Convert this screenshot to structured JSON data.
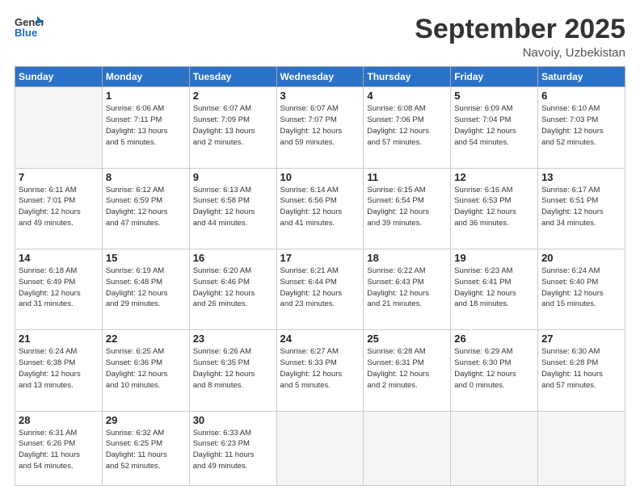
{
  "header": {
    "logo_line1": "General",
    "logo_line2": "Blue",
    "month_title": "September 2025",
    "location": "Navoiy, Uzbekistan"
  },
  "weekdays": [
    "Sunday",
    "Monday",
    "Tuesday",
    "Wednesday",
    "Thursday",
    "Friday",
    "Saturday"
  ],
  "weeks": [
    [
      {
        "day": "",
        "info": ""
      },
      {
        "day": "1",
        "info": "Sunrise: 6:06 AM\nSunset: 7:11 PM\nDaylight: 13 hours\nand 5 minutes."
      },
      {
        "day": "2",
        "info": "Sunrise: 6:07 AM\nSunset: 7:09 PM\nDaylight: 13 hours\nand 2 minutes."
      },
      {
        "day": "3",
        "info": "Sunrise: 6:07 AM\nSunset: 7:07 PM\nDaylight: 12 hours\nand 59 minutes."
      },
      {
        "day": "4",
        "info": "Sunrise: 6:08 AM\nSunset: 7:06 PM\nDaylight: 12 hours\nand 57 minutes."
      },
      {
        "day": "5",
        "info": "Sunrise: 6:09 AM\nSunset: 7:04 PM\nDaylight: 12 hours\nand 54 minutes."
      },
      {
        "day": "6",
        "info": "Sunrise: 6:10 AM\nSunset: 7:03 PM\nDaylight: 12 hours\nand 52 minutes."
      }
    ],
    [
      {
        "day": "7",
        "info": "Sunrise: 6:11 AM\nSunset: 7:01 PM\nDaylight: 12 hours\nand 49 minutes."
      },
      {
        "day": "8",
        "info": "Sunrise: 6:12 AM\nSunset: 6:59 PM\nDaylight: 12 hours\nand 47 minutes."
      },
      {
        "day": "9",
        "info": "Sunrise: 6:13 AM\nSunset: 6:58 PM\nDaylight: 12 hours\nand 44 minutes."
      },
      {
        "day": "10",
        "info": "Sunrise: 6:14 AM\nSunset: 6:56 PM\nDaylight: 12 hours\nand 41 minutes."
      },
      {
        "day": "11",
        "info": "Sunrise: 6:15 AM\nSunset: 6:54 PM\nDaylight: 12 hours\nand 39 minutes."
      },
      {
        "day": "12",
        "info": "Sunrise: 6:16 AM\nSunset: 6:53 PM\nDaylight: 12 hours\nand 36 minutes."
      },
      {
        "day": "13",
        "info": "Sunrise: 6:17 AM\nSunset: 6:51 PM\nDaylight: 12 hours\nand 34 minutes."
      }
    ],
    [
      {
        "day": "14",
        "info": "Sunrise: 6:18 AM\nSunset: 6:49 PM\nDaylight: 12 hours\nand 31 minutes."
      },
      {
        "day": "15",
        "info": "Sunrise: 6:19 AM\nSunset: 6:48 PM\nDaylight: 12 hours\nand 29 minutes."
      },
      {
        "day": "16",
        "info": "Sunrise: 6:20 AM\nSunset: 6:46 PM\nDaylight: 12 hours\nand 26 minutes."
      },
      {
        "day": "17",
        "info": "Sunrise: 6:21 AM\nSunset: 6:44 PM\nDaylight: 12 hours\nand 23 minutes."
      },
      {
        "day": "18",
        "info": "Sunrise: 6:22 AM\nSunset: 6:43 PM\nDaylight: 12 hours\nand 21 minutes."
      },
      {
        "day": "19",
        "info": "Sunrise: 6:23 AM\nSunset: 6:41 PM\nDaylight: 12 hours\nand 18 minutes."
      },
      {
        "day": "20",
        "info": "Sunrise: 6:24 AM\nSunset: 6:40 PM\nDaylight: 12 hours\nand 15 minutes."
      }
    ],
    [
      {
        "day": "21",
        "info": "Sunrise: 6:24 AM\nSunset: 6:38 PM\nDaylight: 12 hours\nand 13 minutes."
      },
      {
        "day": "22",
        "info": "Sunrise: 6:25 AM\nSunset: 6:36 PM\nDaylight: 12 hours\nand 10 minutes."
      },
      {
        "day": "23",
        "info": "Sunrise: 6:26 AM\nSunset: 6:35 PM\nDaylight: 12 hours\nand 8 minutes."
      },
      {
        "day": "24",
        "info": "Sunrise: 6:27 AM\nSunset: 6:33 PM\nDaylight: 12 hours\nand 5 minutes."
      },
      {
        "day": "25",
        "info": "Sunrise: 6:28 AM\nSunset: 6:31 PM\nDaylight: 12 hours\nand 2 minutes."
      },
      {
        "day": "26",
        "info": "Sunrise: 6:29 AM\nSunset: 6:30 PM\nDaylight: 12 hours\nand 0 minutes."
      },
      {
        "day": "27",
        "info": "Sunrise: 6:30 AM\nSunset: 6:28 PM\nDaylight: 11 hours\nand 57 minutes."
      }
    ],
    [
      {
        "day": "28",
        "info": "Sunrise: 6:31 AM\nSunset: 6:26 PM\nDaylight: 11 hours\nand 54 minutes."
      },
      {
        "day": "29",
        "info": "Sunrise: 6:32 AM\nSunset: 6:25 PM\nDaylight: 11 hours\nand 52 minutes."
      },
      {
        "day": "30",
        "info": "Sunrise: 6:33 AM\nSunset: 6:23 PM\nDaylight: 11 hours\nand 49 minutes."
      },
      {
        "day": "",
        "info": ""
      },
      {
        "day": "",
        "info": ""
      },
      {
        "day": "",
        "info": ""
      },
      {
        "day": "",
        "info": ""
      }
    ]
  ]
}
